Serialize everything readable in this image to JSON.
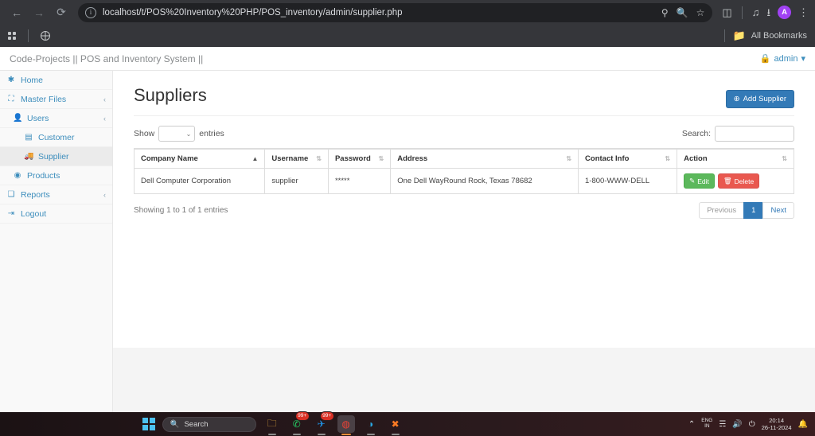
{
  "browser": {
    "url": "localhost/t/POS%20Inventory%20PHP/POS_inventory/admin/supplier.php",
    "back_icon": "←",
    "forward_icon": "→",
    "reload_icon": "⟳",
    "info_icon": "i",
    "omnibox_icons": [
      "key-icon",
      "zoom-search-icon",
      "bookmark-star-icon"
    ],
    "toolbar_icons": [
      "extensions-icon",
      "media-control-icon",
      "downloads-icon"
    ],
    "profile_initial": "A",
    "menu_icon": "⋮",
    "bookmarks": {
      "apps_icon": "apps-grid-icon",
      "site_icon": "globe-icon",
      "all_bookmarks_label": "All Bookmarks",
      "folder_icon": "folder-icon"
    }
  },
  "app": {
    "brand": "Code-Projects || POS and Inventory System ||",
    "user": {
      "lock_icon": "🔒",
      "label": "admin",
      "caret": "▾"
    }
  },
  "sidebar": {
    "items": [
      {
        "label": "Home",
        "icon": "✱",
        "level": 0,
        "caret": "",
        "active": false
      },
      {
        "label": "Master Files",
        "icon": "⛶",
        "level": 0,
        "caret": "‹",
        "active": false
      },
      {
        "label": "Users",
        "icon": "👤",
        "level": 1,
        "caret": "‹",
        "active": false
      },
      {
        "label": "Customer",
        "icon": "▤",
        "level": 2,
        "caret": "",
        "active": false
      },
      {
        "label": "Supplier",
        "icon": "🚚",
        "level": 2,
        "caret": "",
        "active": true
      },
      {
        "label": "Products",
        "icon": "◉",
        "level": 1,
        "caret": "",
        "active": false
      },
      {
        "label": "Reports",
        "icon": "❏",
        "level": 0,
        "caret": "‹",
        "active": false
      },
      {
        "label": "Logout",
        "icon": "⇥",
        "level": 0,
        "caret": "",
        "active": false
      }
    ]
  },
  "main": {
    "title": "Suppliers",
    "add_button": {
      "label": "Add Supplier",
      "icon": "⊕"
    },
    "datatable": {
      "length_label_before": "Show",
      "length_label_after": "entries",
      "length_value": "",
      "length_caret": "⌄",
      "search_label": "Search:",
      "search_value": "",
      "columns": [
        {
          "label": "Company Name",
          "sort": "asc"
        },
        {
          "label": "Username",
          "sort": "neutral"
        },
        {
          "label": "Password",
          "sort": "neutral"
        },
        {
          "label": "Address",
          "sort": "neutral"
        },
        {
          "label": "Contact Info",
          "sort": "neutral"
        },
        {
          "label": "Action",
          "sort": "neutral"
        }
      ],
      "rows": [
        {
          "company_name": "Dell Computer Corporation",
          "username": "supplier",
          "password": "*****",
          "address": "One Dell WayRound Rock, Texas 78682",
          "contact_info": "1-800-WWW-DELL",
          "edit_label": "Edit",
          "edit_icon": "✎",
          "delete_label": "Delete",
          "delete_icon": "🗑"
        }
      ],
      "info": "Showing 1 to 1 of 1 entries",
      "pagination": {
        "previous": "Previous",
        "pages": [
          "1"
        ],
        "next": "Next",
        "current": "1"
      }
    }
  },
  "taskbar": {
    "start_icon": "windows-logo-icon",
    "search_placeholder": "Search",
    "search_icon": "🔍",
    "apps": [
      {
        "name": "file-explorer-icon",
        "glyph": "🗀",
        "badge": "",
        "color": "#f2b544"
      },
      {
        "name": "whatsapp-icon",
        "glyph": "✆",
        "badge": "99+",
        "color": "#25d366"
      },
      {
        "name": "messenger-icon",
        "glyph": "✈",
        "badge": "99+",
        "color": "#1f8fe0"
      },
      {
        "name": "chrome-icon",
        "glyph": "◍",
        "badge": "",
        "color": "#e94235"
      },
      {
        "name": "edge-icon",
        "glyph": "◑",
        "badge": "",
        "color": "#2aa6e0"
      },
      {
        "name": "xampp-icon",
        "glyph": "✖",
        "badge": "",
        "color": "#fb7a24"
      }
    ],
    "tray": {
      "chevron": "⌃",
      "language": "ENG",
      "language_sub": "IN",
      "wifi_icon": "📶",
      "volume_icon": "🔊",
      "battery_icon": "🔋",
      "time": "20:14",
      "date": "26-11-2024",
      "notification_icon": "🔔"
    }
  },
  "colors": {
    "accent_blue": "#337ab7",
    "sidebar_link": "#3c8dbc",
    "edit_green": "#5cb85c",
    "delete_red": "#e9584f"
  }
}
